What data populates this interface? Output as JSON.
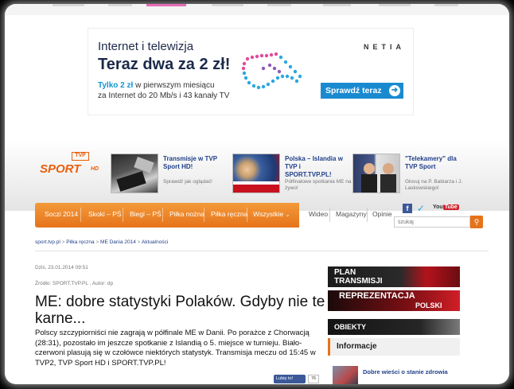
{
  "ad": {
    "line1": "Internet i telewizja",
    "line2": "Teraz dwa za 2 zł!",
    "offer_highlight": "Tylko 2 zł",
    "offer_rest": "w pierwszym miesiącu",
    "offer_line2": "za Internet do 20 Mb/s i 43 kanały TV",
    "brand": "NETIA",
    "cta": "Sprawdź teraz",
    "cta_icon": "arrow-right-icon",
    "colors": {
      "accent": "#1a8ad0",
      "headline": "#1c2a4a",
      "dots_pink": "#e04b9c",
      "dots_blue": "#2aa7df"
    }
  },
  "logo": {
    "tvp": "TVP",
    "sport": "SPORT",
    "hd": "HD"
  },
  "promos": [
    {
      "title": "Transmisje w TVP Sport HD!",
      "desc": "Sprawdź jak oglądać!"
    },
    {
      "title": "Polska – Islandia w TVP i SPORT.TVP.PL!",
      "desc": "Półfinałowe spotkania ME na żywo!"
    },
    {
      "title": "\"Telekamery\" dla TVP Sport",
      "desc": "Głosuj na P. Babiarza i J. Laskowskiego!"
    }
  ],
  "nav": {
    "main": [
      "Soczi 2014",
      "Skoki – PŚ",
      "Biegi – PŚ",
      "Piłka nożna",
      "Piłka ręczna",
      "Wszystkie"
    ],
    "dropdown_icon": "chevron-down-icon",
    "secondary": [
      "Wideo",
      "Magazyny",
      "Opinie"
    ],
    "search_placeholder": "szukaj",
    "search_icon": "search-icon",
    "youtube_you": "You",
    "youtube_tube": "Tube",
    "colors": {
      "nav_orange": "#e6731a",
      "link_blue": "#1f3f8a"
    }
  },
  "breadcrumb": [
    "sport.tvp.pl",
    "Piłka ręczna",
    "ME Dania 2014",
    "Aktualności"
  ],
  "article": {
    "date": "Dziś, 23.01.2014 09:51",
    "source": "Źródło: SPORT.TVP.PL , Autor: dp",
    "headline": "ME: dobre statystyki Polaków. Gdyby nie te karne...",
    "lead": "Polscy szczypiorniści nie zagrają w półfinale ME w Danii. Po porażce z Chorwacją (28:31), pozostało im jeszcze spotkanie z Islandią o 5. miejsce w turnieju. Biało-czerwoni plasują się w czołówce niektórych statystyk. Transmisja meczu od 15:45 w TVP2, TVP Sport HD i SPORT.TVP.PL!",
    "follow_label": "Lubię to!",
    "follow_count": "76"
  },
  "sidebar": {
    "plan_line1": "PLAN",
    "plan_line2": "TRANSMISJI",
    "repre_line1": "REPREZENTACJA",
    "repre_line2": "POLSKI",
    "obiekty": "OBIEKTY",
    "info_heading": "Informacje",
    "news_title": "Dobre wieści o stanie zdrowia"
  }
}
